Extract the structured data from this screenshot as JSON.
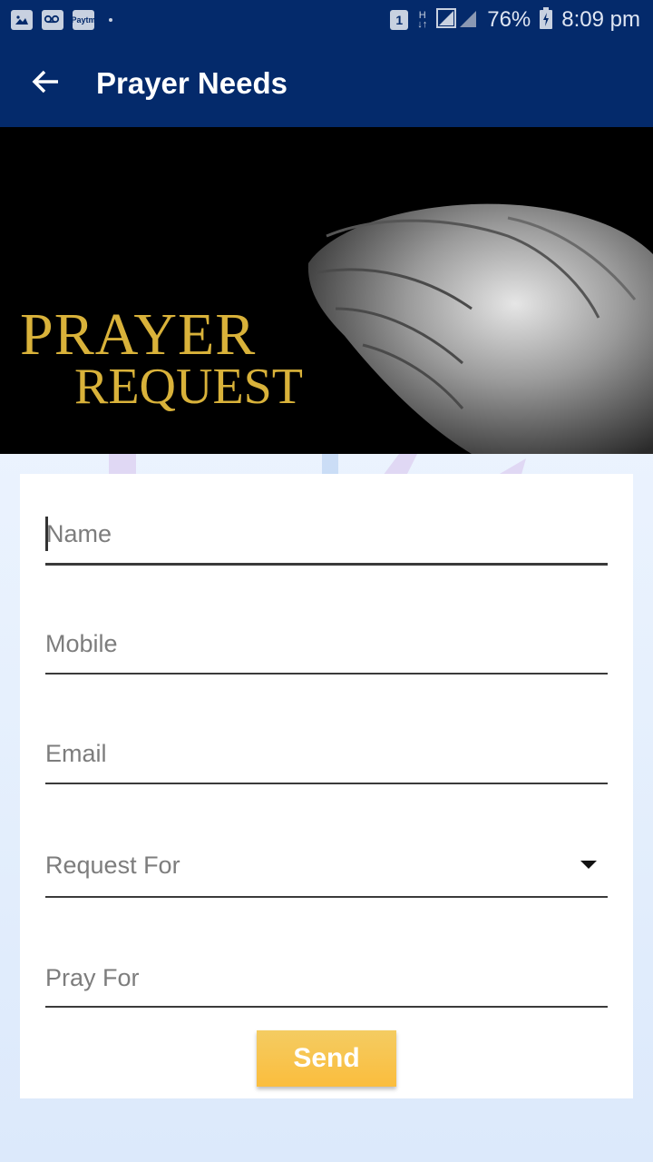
{
  "status_bar": {
    "paytm": "Paytm",
    "sim": "1",
    "network": "H",
    "battery": "76%",
    "time": "8:09 pm"
  },
  "app_bar": {
    "title": "Prayer Needs"
  },
  "banner": {
    "line1": "PRAYER",
    "line2": "REQUEST"
  },
  "form": {
    "name_placeholder": "Name",
    "mobile_placeholder": "Mobile",
    "email_placeholder": "Email",
    "request_for_label": "Request For",
    "pray_for_placeholder": "Pray For",
    "send_label": "Send"
  },
  "colors": {
    "app_bar": "#042a6b",
    "button": "#fbbd3d",
    "banner_text": "#d9b23a"
  }
}
